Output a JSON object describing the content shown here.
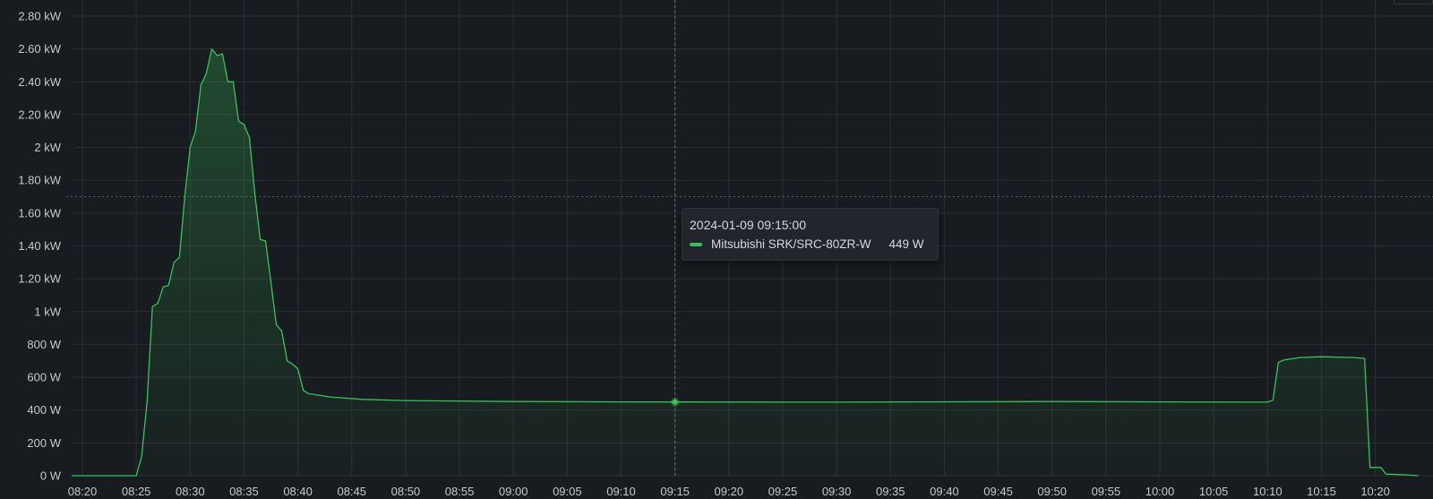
{
  "chart_data": {
    "type": "area",
    "title": "",
    "xlabel": "",
    "ylabel": "",
    "x_ticks": [
      "08:20",
      "08:25",
      "08:30",
      "08:35",
      "08:40",
      "08:45",
      "08:50",
      "08:55",
      "09:00",
      "09:05",
      "09:10",
      "09:15",
      "09:20",
      "09:25",
      "09:30",
      "09:35",
      "09:40",
      "09:45",
      "09:50",
      "09:55",
      "10:00",
      "10:05",
      "10:10",
      "10:15",
      "10:20"
    ],
    "y_ticks": [
      "0 W",
      "200 W",
      "400 W",
      "600 W",
      "800 W",
      "1 kW",
      "1.20 kW",
      "1.40 kW",
      "1.60 kW",
      "1.80 kW",
      "2 kW",
      "2.20 kW",
      "2.40 kW",
      "2.60 kW",
      "2.80 kW"
    ],
    "ylim": [
      0,
      2800
    ],
    "x_range": [
      "08:20",
      "10:24"
    ],
    "threshold_line": 1700,
    "grid": true,
    "series": [
      {
        "name": "Mitsubishi SRK/SRC-80ZR-W",
        "color": "#37c35a",
        "points": [
          [
            "08:19",
            0
          ],
          [
            "08:25",
            0
          ],
          [
            "08:25:30",
            120
          ],
          [
            "08:26",
            450
          ],
          [
            "08:26:30",
            1030
          ],
          [
            "08:27",
            1050
          ],
          [
            "08:27:30",
            1150
          ],
          [
            "08:28",
            1160
          ],
          [
            "08:28:30",
            1300
          ],
          [
            "08:29",
            1330
          ],
          [
            "08:29:30",
            1700
          ],
          [
            "08:30",
            2000
          ],
          [
            "08:30:30",
            2100
          ],
          [
            "08:31",
            2380
          ],
          [
            "08:31:30",
            2450
          ],
          [
            "08:32",
            2600
          ],
          [
            "08:32:30",
            2560
          ],
          [
            "08:33",
            2570
          ],
          [
            "08:33:30",
            2400
          ],
          [
            "08:34",
            2400
          ],
          [
            "08:34:30",
            2160
          ],
          [
            "08:35",
            2140
          ],
          [
            "08:35:30",
            2060
          ],
          [
            "08:36",
            1720
          ],
          [
            "08:36:30",
            1440
          ],
          [
            "08:37",
            1430
          ],
          [
            "08:37:30",
            1180
          ],
          [
            "08:38",
            920
          ],
          [
            "08:38:30",
            880
          ],
          [
            "08:39",
            700
          ],
          [
            "08:39:30",
            680
          ],
          [
            "08:40",
            650
          ],
          [
            "08:40:30",
            520
          ],
          [
            "08:41",
            500
          ],
          [
            "08:43",
            480
          ],
          [
            "08:46",
            465
          ],
          [
            "08:50",
            458
          ],
          [
            "09:00",
            452
          ],
          [
            "09:10",
            450
          ],
          [
            "09:15",
            449
          ],
          [
            "09:30",
            448
          ],
          [
            "09:50",
            452
          ],
          [
            "10:00",
            450
          ],
          [
            "10:10",
            448
          ],
          [
            "10:10:30",
            460
          ],
          [
            "10:11",
            690
          ],
          [
            "10:11:30",
            705
          ],
          [
            "10:13",
            720
          ],
          [
            "10:15",
            725
          ],
          [
            "10:18",
            720
          ],
          [
            "10:19",
            715
          ],
          [
            "10:19:30",
            50
          ],
          [
            "10:20:30",
            50
          ],
          [
            "10:21",
            10
          ],
          [
            "10:23",
            5
          ],
          [
            "10:24",
            0
          ]
        ]
      }
    ],
    "hover": {
      "x": "09:15",
      "time_label": "2024-01-09 09:15:00",
      "series_name": "Mitsubishi SRK/SRC-80ZR-W",
      "value_label": "449 W",
      "value": 449
    },
    "colors": {
      "background": "#181b1f",
      "grid": "#2c2f35",
      "line": "#37c35a",
      "threshold": "#5b5e64"
    }
  }
}
